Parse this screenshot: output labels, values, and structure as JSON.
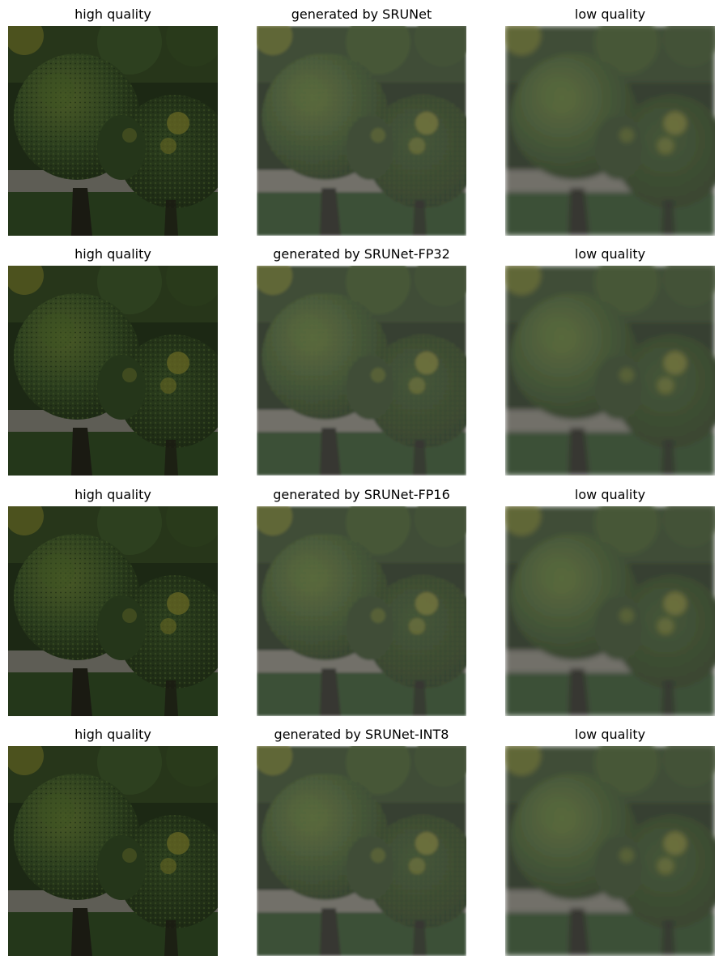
{
  "rows": [
    {
      "titles": [
        "high quality",
        "generated by SRUNet",
        "low quality"
      ]
    },
    {
      "titles": [
        "high quality",
        "generated by SRUNet-FP32",
        "low quality"
      ]
    },
    {
      "titles": [
        "high quality",
        "generated by SRUNet-FP16",
        "low quality"
      ]
    },
    {
      "titles": [
        "high quality",
        "generated by SRUNet-INT8",
        "low quality"
      ]
    }
  ],
  "colors": {
    "background": "#ffffff",
    "foliage_dark": "#1d2a14",
    "foliage_mid": "#2c3f1e",
    "foliage_light": "#4a5a26",
    "foliage_yellow": "#6b6a23",
    "path_gray": "#5e5d55",
    "grass": "#24371a",
    "trunk": "#1a1a12"
  }
}
